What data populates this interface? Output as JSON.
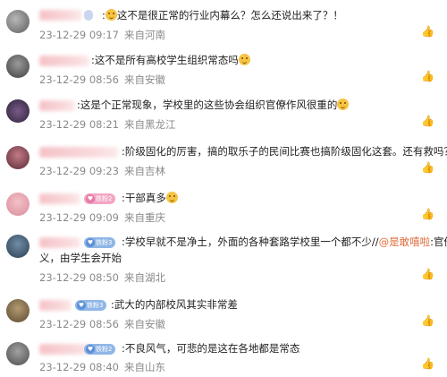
{
  "comments": [
    {
      "text_before": ":",
      "text_main": "这不是很正常的行业内幕么？怎么还说出来了？！",
      "time": "23-12-29 09:17",
      "location": "来自河南",
      "badge": null
    },
    {
      "text_before": ":",
      "text_main": "这不是所有高校学生组织常态吗",
      "time": "23-12-29 08:56",
      "location": "来自安徽",
      "badge": null
    },
    {
      "text_before": "",
      "text_main": ":这是个正常现象，学校里的这些协会组织官僚作风很重的",
      "time": "23-12-29 08:21",
      "location": "来自黑龙江",
      "badge": null
    },
    {
      "text_before": "",
      "text_main": ":阶级固化的厉害，搞的取乐子的民间比赛也搞阶级固化这套。还有救吗？",
      "time": "23-12-29 09:23",
      "location": "来自吉林",
      "badge": null
    },
    {
      "text_before": "",
      "text_main": ":干部真多",
      "time": "23-12-29 09:09",
      "location": "来自重庆",
      "badge": "铁粉2"
    },
    {
      "text_before": "",
      "text_main": ":学校早就不是净土，外面的各种套路学校里一个都不少//",
      "mention": "@是敢嘻啦",
      "text_after": ":官僚主",
      "line2": "义，由学生会开始",
      "time": "23-12-29 08:50",
      "location": "来自湖北",
      "badge": "铁粉3"
    },
    {
      "text_before": "",
      "text_main": ":武大的内部校风其实非常差",
      "time": "23-12-29 08:56",
      "location": "来自安徽",
      "badge": "铁粉3"
    },
    {
      "text_before": "",
      "text_main": ":不良风气，可悲的是这在各地都是常态",
      "time": "23-12-29 08:40",
      "location": "来自山东",
      "badge": "铁粉2"
    }
  ],
  "icons": {
    "like": "thumbs-up-icon",
    "emoji": "smile-emoji-icon"
  },
  "colors": {
    "meta": "#8a8a8a",
    "mention": "#e06b3a",
    "badge_blue": "#8fb6e6",
    "badge_pink": "#f3a6c4"
  }
}
